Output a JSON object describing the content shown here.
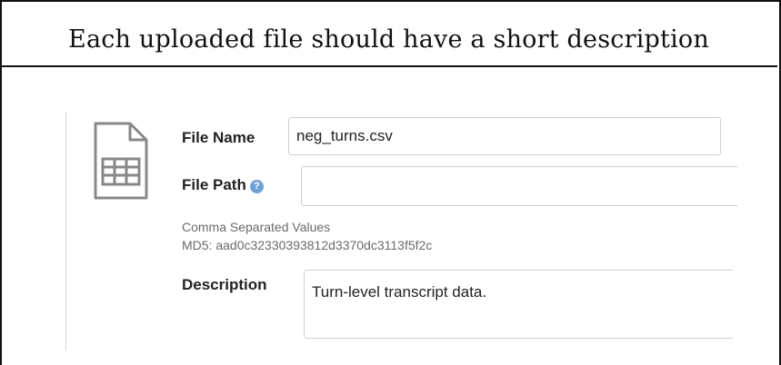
{
  "header": {
    "title": "Each uploaded file should have a short description"
  },
  "file": {
    "icon": "spreadsheet-file-icon",
    "name_label": "File Name",
    "name_value": "neg_turns.csv",
    "path_label": "File Path",
    "path_help_icon": "question-circle-icon",
    "path_value": "",
    "type_text": "Comma Separated Values",
    "md5_text": "MD5: aad0c32330393812d3370dc3113f5f2c",
    "description_label": "Description",
    "description_value": "Turn-level transcript data."
  },
  "colors": {
    "help_icon": "#6ea1d8",
    "border": "#cfcfcf"
  }
}
